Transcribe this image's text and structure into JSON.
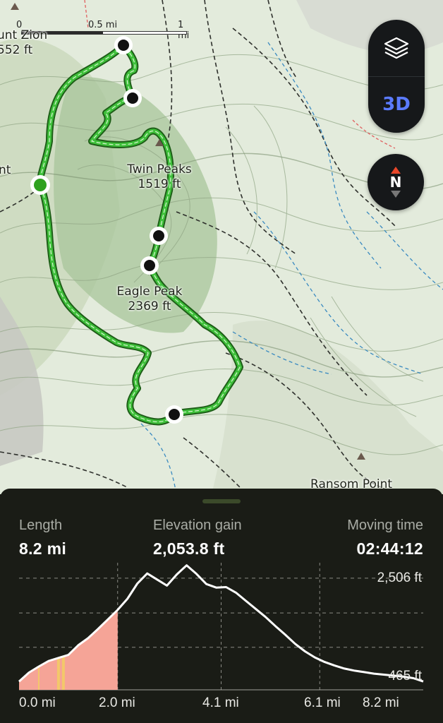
{
  "map": {
    "scale": {
      "zero": "0",
      "half": "0.5 mi",
      "one": "1 mi"
    },
    "labels": {
      "mount_zion_name": "unt Zion",
      "mount_zion_elev": "552 ft",
      "left_partial": "nt",
      "twin_peaks_name": "Twin Peaks",
      "twin_peaks_elev": "1519 ft",
      "eagle_peak_name": "Eagle Peak",
      "eagle_peak_elev": "2369 ft",
      "ransom_point_name": "Ransom Point"
    },
    "controls": {
      "layers_icon": "layers-icon",
      "three_d_label": "3D",
      "compass_label": "N"
    },
    "colors": {
      "trail": "#3ec03a",
      "trail_outline": "#1e5f18",
      "start_marker": "#2fa11f",
      "accent_3d": "#5b7bff",
      "compass_north": "#e9472a"
    }
  },
  "stats": {
    "length": {
      "label": "Length",
      "value": "8.2 mi"
    },
    "elevation_gain": {
      "label": "Elevation gain",
      "value": "2,053.8 ft"
    },
    "moving_time": {
      "label": "Moving time",
      "value": "02:44:12"
    }
  },
  "chart_data": {
    "type": "area",
    "xlabel": "",
    "ylabel": "",
    "x_ticks": [
      "0.0 mi",
      "2.0 mi",
      "4.1 mi",
      "6.1 mi",
      "8.2 mi"
    ],
    "y_ticks": [
      "2,506 ft",
      "465 ft"
    ],
    "xlim": [
      0,
      8.2
    ],
    "ylim": [
      300,
      2700
    ],
    "highlight_until_mi": 2.0,
    "markers_mi": [
      0.4,
      0.8,
      0.9
    ],
    "colors": {
      "line": "#ffffff",
      "fill_highlight": "#f5a497",
      "marker": "#f3c86a"
    },
    "series": [
      {
        "x": [
          0.0,
          0.2,
          0.4,
          0.6,
          0.8,
          1.0,
          1.2,
          1.4,
          1.6,
          1.8,
          2.0,
          2.2,
          2.4,
          2.6,
          2.8,
          3.0,
          3.2,
          3.4,
          3.6,
          3.8,
          4.0,
          4.2,
          4.4,
          4.6,
          4.8,
          5.0,
          5.2,
          5.4,
          5.6,
          5.8,
          6.0,
          6.2,
          6.4,
          6.6,
          6.8,
          7.0,
          7.2,
          7.4,
          7.6,
          7.8,
          8.0,
          8.2
        ],
        "values": [
          465,
          640,
          760,
          870,
          930,
          990,
          1180,
          1320,
          1500,
          1690,
          1880,
          2100,
          2400,
          2600,
          2480,
          2360,
          2580,
          2760,
          2590,
          2390,
          2320,
          2330,
          2220,
          2060,
          1900,
          1740,
          1560,
          1390,
          1210,
          1060,
          940,
          850,
          780,
          720,
          680,
          650,
          620,
          600,
          580,
          560,
          530,
          465
        ]
      }
    ]
  }
}
